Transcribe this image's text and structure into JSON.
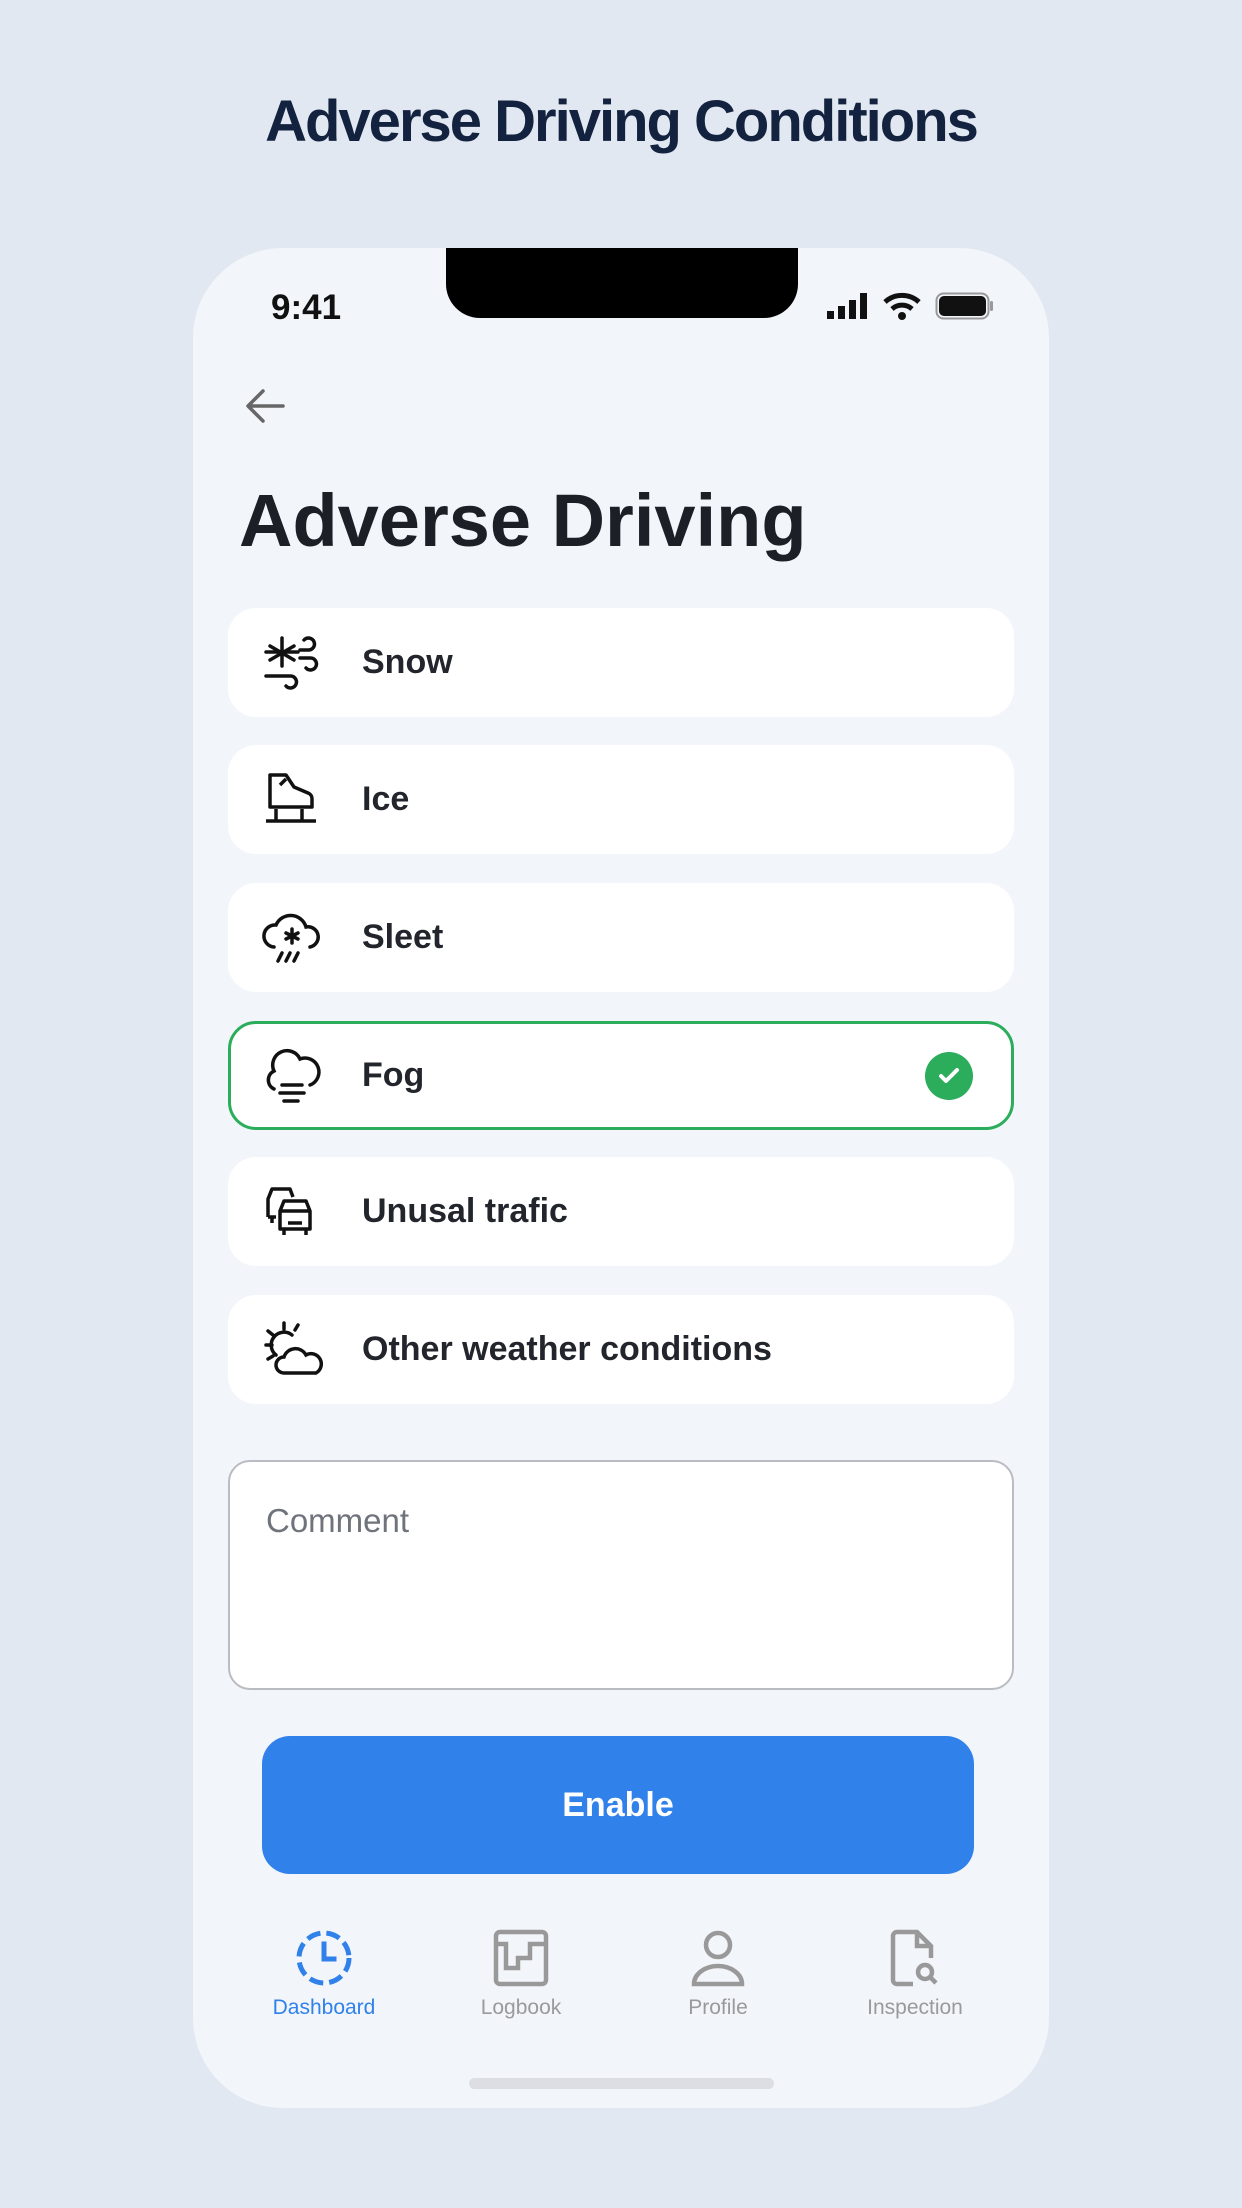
{
  "heading": "Adverse Driving Conditions",
  "status_bar": {
    "time": "9:41"
  },
  "page_title": "Adverse Driving",
  "conditions": [
    {
      "label": "Snow",
      "icon": "snow-wind-icon",
      "selected": false
    },
    {
      "label": "Ice",
      "icon": "ice-skate-icon",
      "selected": false
    },
    {
      "label": "Sleet",
      "icon": "sleet-cloud-icon",
      "selected": false
    },
    {
      "label": "Fog",
      "icon": "fog-cloud-icon",
      "selected": true
    },
    {
      "label": "Unusal trafic",
      "icon": "traffic-cars-icon",
      "selected": false
    },
    {
      "label": "Other weather conditions",
      "icon": "sun-cloud-icon",
      "selected": false
    }
  ],
  "comment": {
    "placeholder": "Comment",
    "value": ""
  },
  "enable_label": "Enable",
  "tabs": [
    {
      "label": "Dashboard",
      "active": true
    },
    {
      "label": "Logbook",
      "active": false
    },
    {
      "label": "Profile",
      "active": false
    },
    {
      "label": "Inspection",
      "active": false
    }
  ],
  "colors": {
    "accent": "#3081ea",
    "selected": "#2bad5c",
    "title": "#13223f"
  }
}
